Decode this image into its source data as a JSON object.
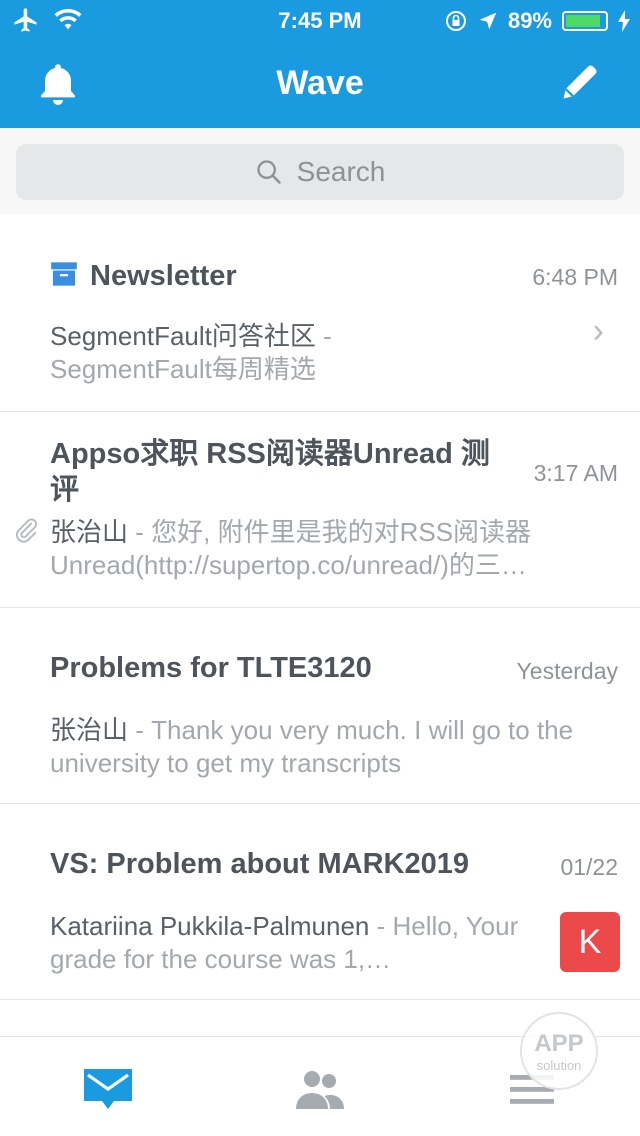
{
  "status_bar": {
    "time": "7:45 PM",
    "battery": "89%",
    "battery_level": 0.89,
    "icons": [
      "airplane-icon",
      "wifi-icon",
      "rotation-lock-icon",
      "location-icon",
      "battery-icon",
      "charging-icon"
    ]
  },
  "nav": {
    "title": "Wave",
    "left_icon": "bell-icon",
    "right_icon": "compose-icon"
  },
  "search": {
    "placeholder": "Search",
    "icon": "search-icon"
  },
  "threads": [
    {
      "title": "Newsletter",
      "time": "6:48 PM",
      "sender": "SegmentFault问答社区",
      "preview": "SegmentFault每周精选",
      "icon": "archive-icon",
      "has_chevron": true
    },
    {
      "title": "Appso求职 RSS阅读器Unread 测评",
      "time": "3:17 AM",
      "sender": "张治山",
      "preview": "您好, 附件里是我的对RSS阅读器Unread(http://supertop.co/unread/)的三…",
      "has_attachment": true
    },
    {
      "title": "Problems for TLTE3120",
      "time": "Yesterday",
      "sender": "张治山",
      "preview": "Thank you very much. I will go to the university to get my transcripts"
    },
    {
      "title": "VS: Problem about MARK2019",
      "time": "01/22",
      "sender": "Katariina Pukkila-Palmunen",
      "preview": "Hello, Your grade for the course was 1,…",
      "avatar_letter": "K",
      "avatar_color": "#ec4a4a"
    }
  ],
  "separator": " - ",
  "tabbar": {
    "items": [
      "inbox-icon",
      "contacts-icon",
      "menu-icon"
    ],
    "active_color": "#1a9be0"
  },
  "watermark": {
    "big": "APP",
    "small": "solution"
  },
  "colors": {
    "header": "#1a9be0",
    "battery_fill": "#4cd964"
  }
}
